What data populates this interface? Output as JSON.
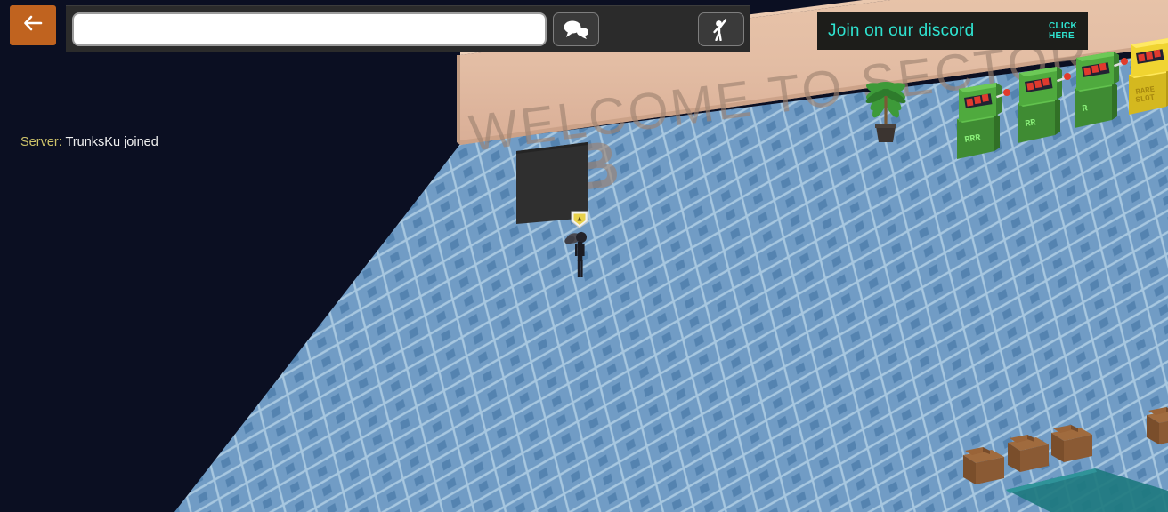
{
  "app": {
    "background_color": "#0b0f22"
  },
  "topbar": {
    "back_button": {
      "icon": "arrow-left-icon",
      "label": "Back",
      "color": "#c0631f"
    },
    "chat_input": {
      "value": "",
      "placeholder": ""
    },
    "buttons": [
      {
        "icon": "speech-bubbles-icon",
        "label": "Chat"
      },
      {
        "icon": "person-raised-arm-icon",
        "label": "Emote"
      }
    ]
  },
  "discord_banner": {
    "title": "Join on our discord",
    "cta_line1": "CLICK",
    "cta_line2": "HERE",
    "accent_color": "#2fe3d0",
    "background_color": "#1d1d1a"
  },
  "server_log": {
    "entries": [
      {
        "prefix": "Server:",
        "text": "TrunksKu joined"
      }
    ],
    "prefix_color": "#cfc46a",
    "text_color": "#f2f2f2"
  },
  "scene": {
    "wall": {
      "sign_line1": "WELCOME TO SECTOR",
      "sign_line2": "B",
      "wall_color": "#e3bda4",
      "sign_text_color": "#a08572"
    },
    "floor": {
      "tile_color": "#7fa9cf",
      "grid_color": "#b7d4ea",
      "accent_tile_color": "#4a7aa8"
    },
    "doorway": {
      "label": "doorway",
      "color": "#333333"
    },
    "plant": {
      "label": "potted-palm",
      "leaf_color": "#3f9a3a",
      "pot_color": "#3b3430"
    },
    "player": {
      "label": "player-character",
      "body_color": "#1b1b22",
      "badge": "shield-badge-icon",
      "badge_color": "#e8d14a"
    },
    "slot_machines": [
      {
        "label": "RRR",
        "color": "#4faa3e",
        "rarity": "common"
      },
      {
        "label": "RR",
        "color": "#4faa3e",
        "rarity": "common"
      },
      {
        "label": "R",
        "color": "#4faa3e",
        "rarity": "common"
      },
      {
        "label": "RARE SLOT",
        "color": "#f0d431",
        "rarity": "rare"
      }
    ],
    "crates": {
      "count": 4,
      "color": "#8a5a34"
    },
    "mat": {
      "label": "floor-mat",
      "color": "#1e7a7f"
    }
  }
}
